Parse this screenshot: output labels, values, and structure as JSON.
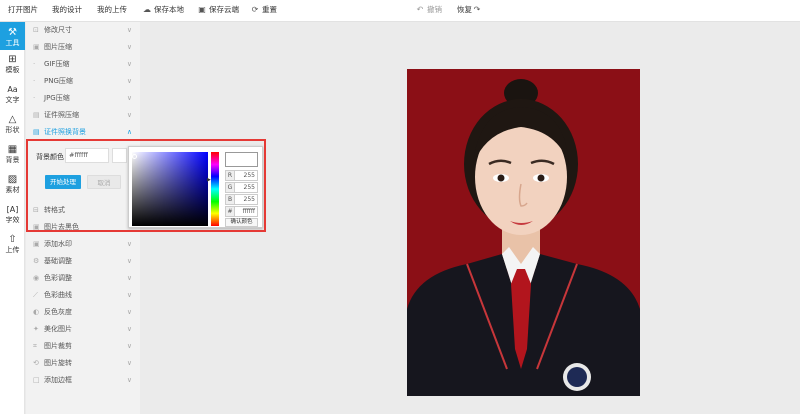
{
  "toolbar": {
    "open_image": "打开图片",
    "my_designs": "我的设计",
    "my_uploads": "我的上传",
    "save_local": "保存本地",
    "save_cloud": "保存云端",
    "reset": "重置",
    "undo": "撤销",
    "redo": "恢复"
  },
  "rail": {
    "tools": "工具",
    "templates": "模板",
    "text": "文字",
    "shapes": "形状",
    "background": "背景",
    "materials": "素材",
    "effects": "字效",
    "upload": "上传"
  },
  "panel": {
    "items_top": [
      "修改尺寸",
      "图片压缩",
      "GIF压缩",
      "PNG压缩",
      "JPG压缩",
      "证件照压缩"
    ],
    "active_item": "证件照换背景",
    "items_bottom": [
      "转格式",
      "图片去黑色",
      "添加水印",
      "基础调整",
      "色彩调整",
      "色彩曲线",
      "反色灰度",
      "美化图片",
      "图片裁剪",
      "图片旋转",
      "添加边框"
    ]
  },
  "bg_change": {
    "label": "背景颜色",
    "hex_value": "#ffffff",
    "start_button": "开始处理",
    "cancel_button": "取消"
  },
  "color_picker": {
    "r_label": "R",
    "r_value": "255",
    "g_label": "G",
    "g_value": "255",
    "b_label": "B",
    "b_value": "255",
    "hex_label": "#",
    "hex_value": "ffffff",
    "confirm_button": "确认颜色"
  },
  "colors": {
    "accent": "#1ea0e0",
    "photo_background": "#8b0f16",
    "highlight_border": "#e53935"
  }
}
